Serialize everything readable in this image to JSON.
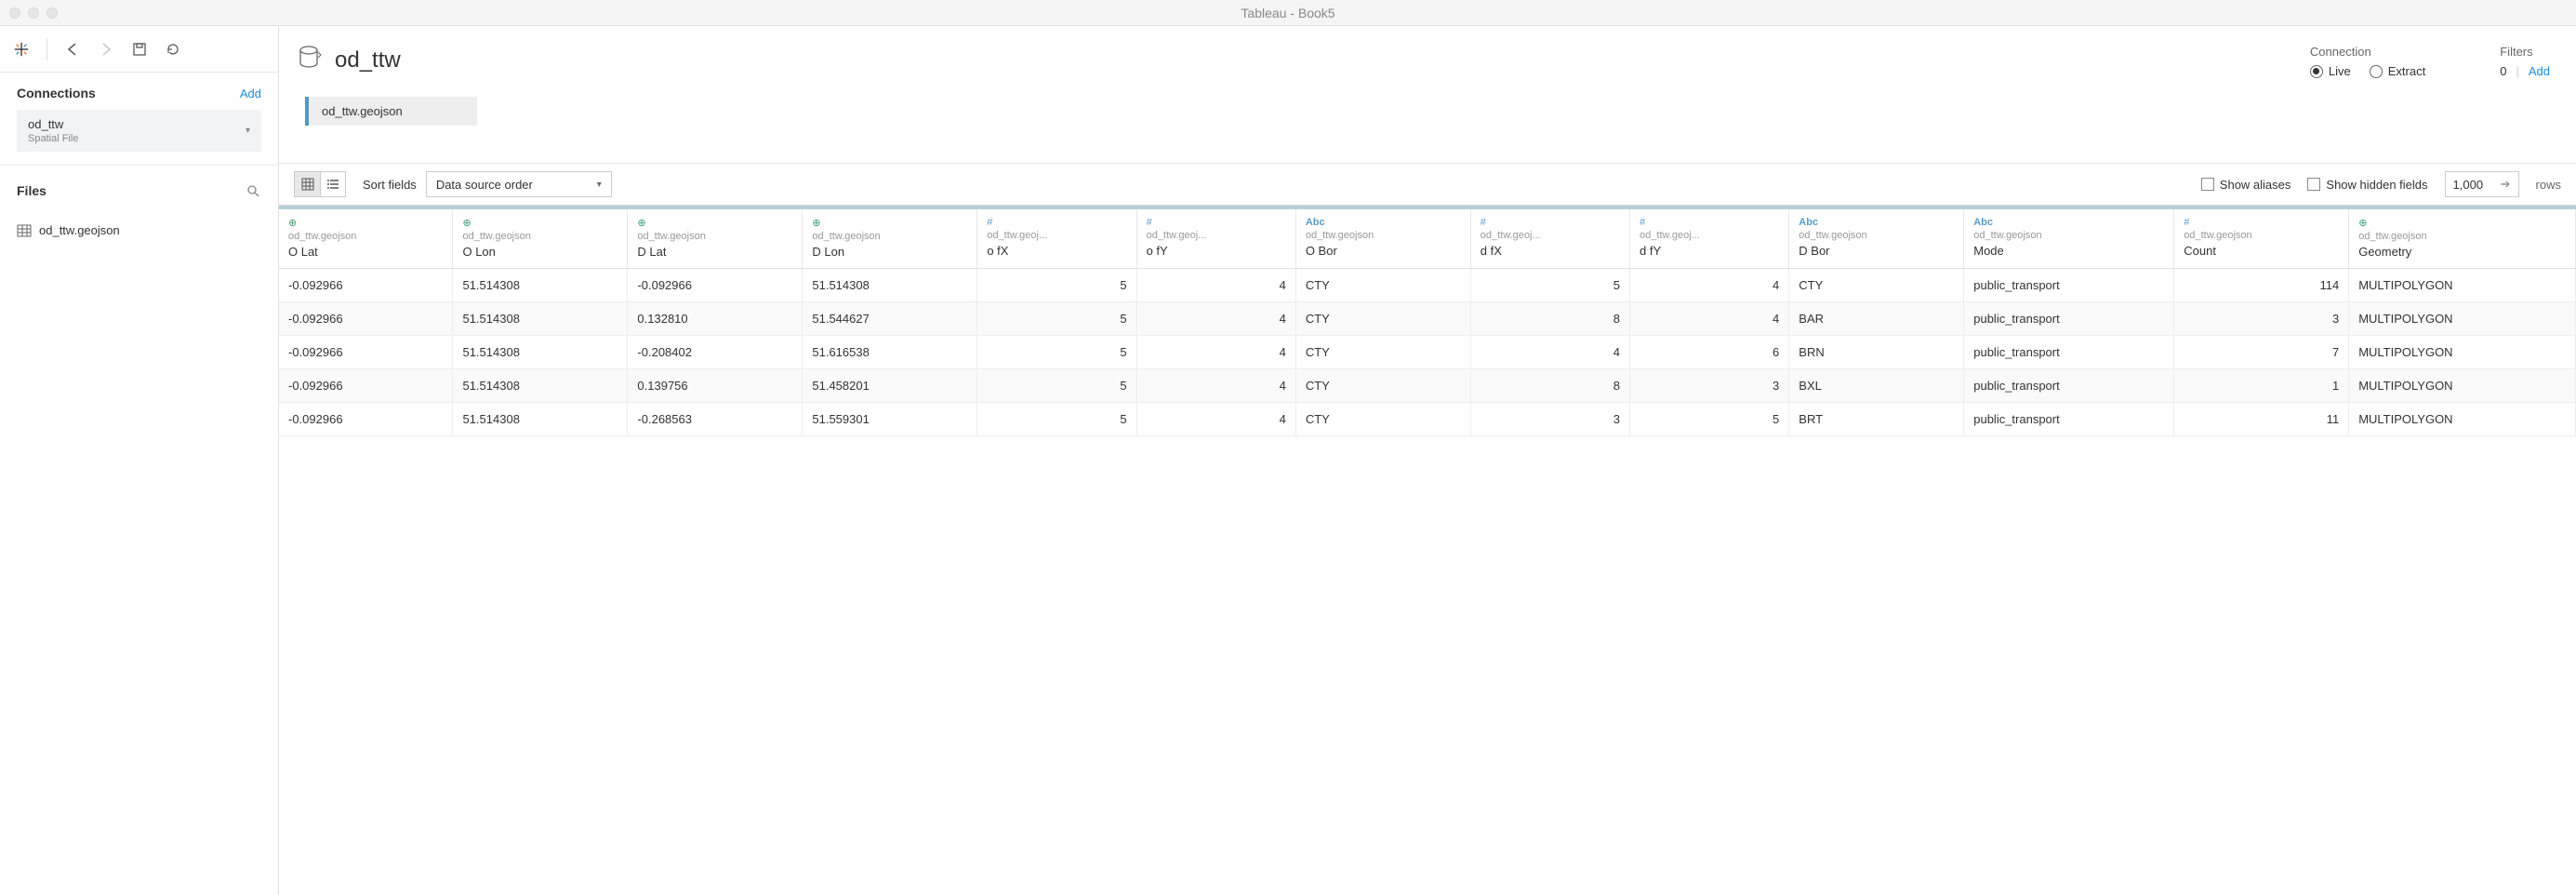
{
  "window": {
    "title": "Tableau - Book5"
  },
  "sidebar": {
    "connections_title": "Connections",
    "add_label": "Add",
    "connection": {
      "name": "od_ttw",
      "type": "Spatial File"
    },
    "files_title": "Files",
    "file_item": "od_ttw.geojson"
  },
  "datasource": {
    "name": "od_ttw",
    "connection_label": "Connection",
    "live_label": "Live",
    "extract_label": "Extract",
    "filters_label": "Filters",
    "filters_count": "0",
    "filters_add": "Add"
  },
  "canvas": {
    "table_name": "od_ttw.geojson"
  },
  "gridbar": {
    "sort_label": "Sort fields",
    "sort_value": "Data source order",
    "show_aliases": "Show aliases",
    "show_hidden": "Show hidden fields",
    "rows_value": "1,000",
    "rows_label": "rows"
  },
  "columns": [
    {
      "type": "globe",
      "icon": "⊕",
      "src": "od_ttw.geojson",
      "name": "O Lat",
      "align": "left"
    },
    {
      "type": "globe",
      "icon": "⊕",
      "src": "od_ttw.geojson",
      "name": "O Lon",
      "align": "left"
    },
    {
      "type": "globe",
      "icon": "⊕",
      "src": "od_ttw.geojson",
      "name": "D Lat",
      "align": "left"
    },
    {
      "type": "globe",
      "icon": "⊕",
      "src": "od_ttw.geojson",
      "name": "D Lon",
      "align": "left"
    },
    {
      "type": "hash",
      "icon": "#",
      "src": "od_ttw.geoj...",
      "name": "o fX",
      "align": "right"
    },
    {
      "type": "hash",
      "icon": "#",
      "src": "od_ttw.geoj...",
      "name": "o fY",
      "align": "right"
    },
    {
      "type": "abc",
      "icon": "Abc",
      "src": "od_ttw.geojson",
      "name": "O Bor",
      "align": "left"
    },
    {
      "type": "hash",
      "icon": "#",
      "src": "od_ttw.geoj...",
      "name": "d fX",
      "align": "right"
    },
    {
      "type": "hash",
      "icon": "#",
      "src": "od_ttw.geoj...",
      "name": "d fY",
      "align": "right"
    },
    {
      "type": "abc",
      "icon": "Abc",
      "src": "od_ttw.geojson",
      "name": "D Bor",
      "align": "left"
    },
    {
      "type": "abc",
      "icon": "Abc",
      "src": "od_ttw.geojson",
      "name": "Mode",
      "align": "left"
    },
    {
      "type": "hash",
      "icon": "#",
      "src": "od_ttw.geojson",
      "name": "Count",
      "align": "right"
    },
    {
      "type": "globe",
      "icon": "⊕",
      "src": "od_ttw.geojson",
      "name": "Geometry",
      "align": "left"
    }
  ],
  "rows": [
    [
      "-0.092966",
      "51.514308",
      "-0.092966",
      "51.514308",
      "5",
      "4",
      "CTY",
      "5",
      "4",
      "CTY",
      "public_transport",
      "114",
      "MULTIPOLYGON"
    ],
    [
      "-0.092966",
      "51.514308",
      "0.132810",
      "51.544627",
      "5",
      "4",
      "CTY",
      "8",
      "4",
      "BAR",
      "public_transport",
      "3",
      "MULTIPOLYGON"
    ],
    [
      "-0.092966",
      "51.514308",
      "-0.208402",
      "51.616538",
      "5",
      "4",
      "CTY",
      "4",
      "6",
      "BRN",
      "public_transport",
      "7",
      "MULTIPOLYGON"
    ],
    [
      "-0.092966",
      "51.514308",
      "0.139756",
      "51.458201",
      "5",
      "4",
      "CTY",
      "8",
      "3",
      "BXL",
      "public_transport",
      "1",
      "MULTIPOLYGON"
    ],
    [
      "-0.092966",
      "51.514308",
      "-0.268563",
      "51.559301",
      "5",
      "4",
      "CTY",
      "3",
      "5",
      "BRT",
      "public_transport",
      "11",
      "MULTIPOLYGON"
    ]
  ]
}
